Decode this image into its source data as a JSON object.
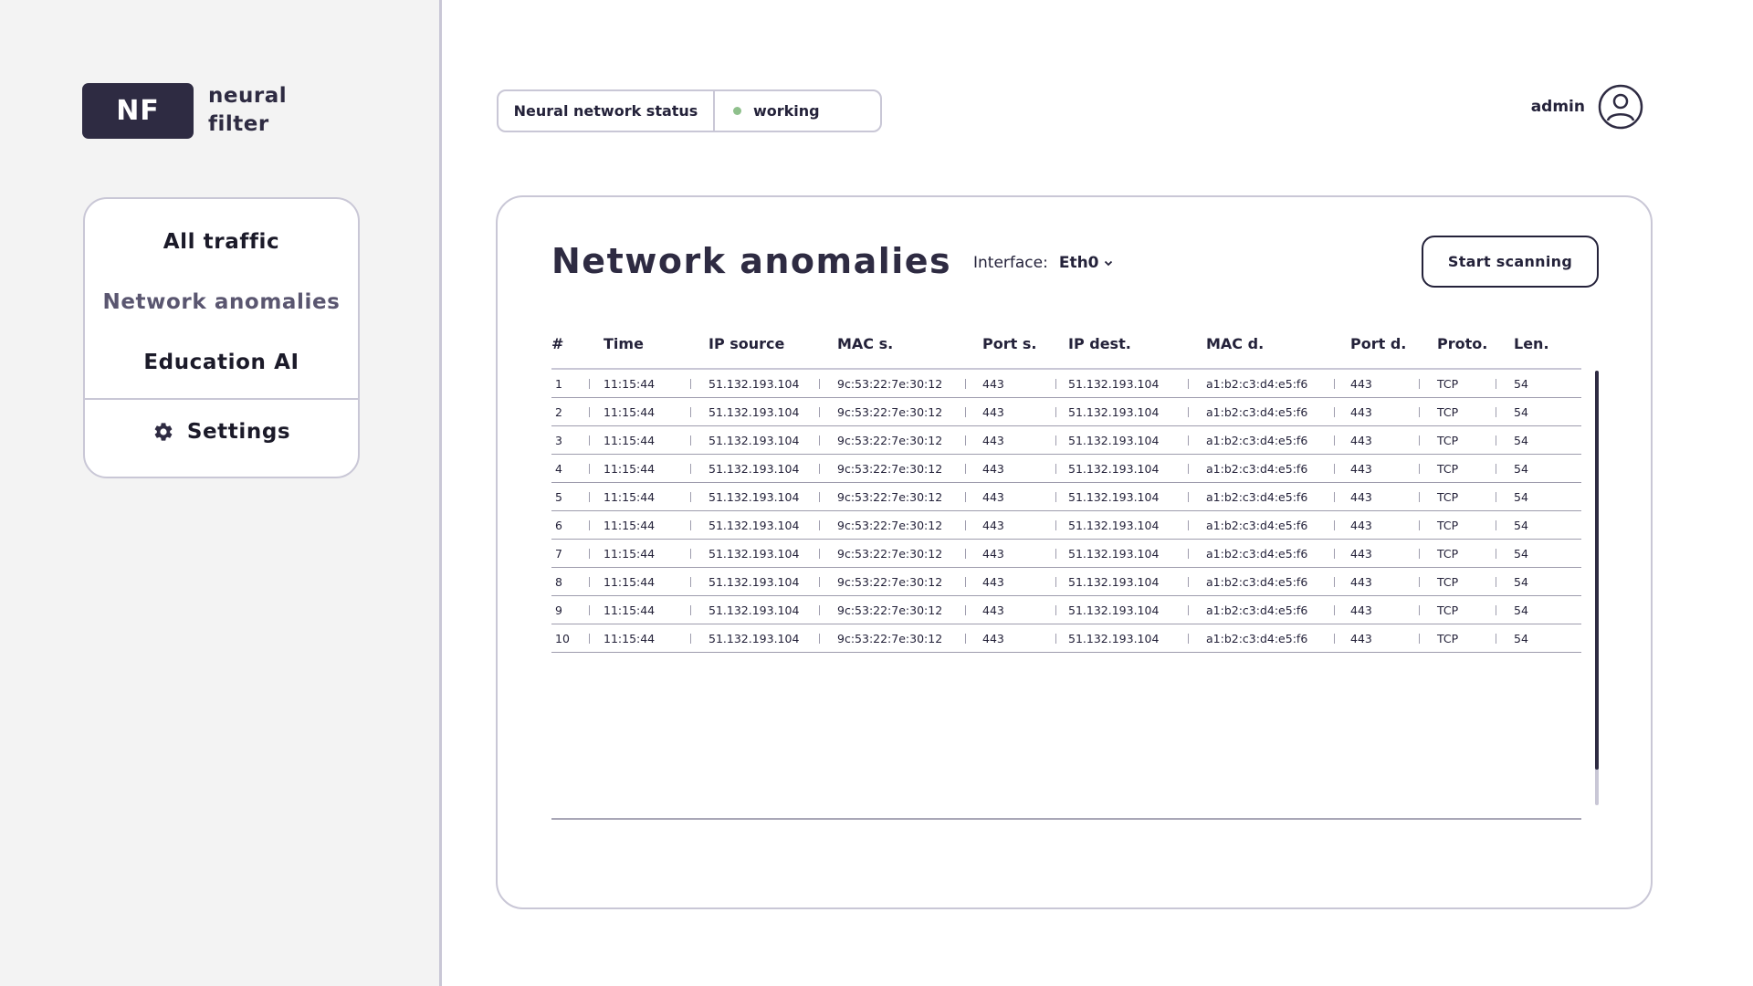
{
  "logo": {
    "badge": "NF",
    "line1": "neural",
    "line2": "filter"
  },
  "nav": {
    "items": [
      {
        "label": "All traffic"
      },
      {
        "label": "Network anomalies"
      },
      {
        "label": "Education AI"
      }
    ],
    "settings_label": "Settings",
    "settings_icon": "gear-icon"
  },
  "status": {
    "label": "Neural network status",
    "value": "working",
    "dot_color": "#8fc08c"
  },
  "user": {
    "name": "admin",
    "icon": "user-circle-icon"
  },
  "main": {
    "title": "Network anomalies",
    "interface_label": "Interface:",
    "interface_value": "Eth0",
    "scan_button": "Start scanning"
  },
  "table": {
    "columns": [
      "#",
      "Time",
      "IP source",
      "MAC s.",
      "Port s.",
      "IP dest.",
      "MAC d.",
      "Port d.",
      "Proto.",
      "Len."
    ],
    "rows": [
      [
        "1",
        "11:15:44",
        "51.132.193.104",
        "9c:53:22:7e:30:12",
        "443",
        "51.132.193.104",
        "a1:b2:c3:d4:e5:f6",
        "443",
        "TCP",
        "54"
      ],
      [
        "2",
        "11:15:44",
        "51.132.193.104",
        "9c:53:22:7e:30:12",
        "443",
        "51.132.193.104",
        "a1:b2:c3:d4:e5:f6",
        "443",
        "TCP",
        "54"
      ],
      [
        "3",
        "11:15:44",
        "51.132.193.104",
        "9c:53:22:7e:30:12",
        "443",
        "51.132.193.104",
        "a1:b2:c3:d4:e5:f6",
        "443",
        "TCP",
        "54"
      ],
      [
        "4",
        "11:15:44",
        "51.132.193.104",
        "9c:53:22:7e:30:12",
        "443",
        "51.132.193.104",
        "a1:b2:c3:d4:e5:f6",
        "443",
        "TCP",
        "54"
      ],
      [
        "5",
        "11:15:44",
        "51.132.193.104",
        "9c:53:22:7e:30:12",
        "443",
        "51.132.193.104",
        "a1:b2:c3:d4:e5:f6",
        "443",
        "TCP",
        "54"
      ],
      [
        "6",
        "11:15:44",
        "51.132.193.104",
        "9c:53:22:7e:30:12",
        "443",
        "51.132.193.104",
        "a1:b2:c3:d4:e5:f6",
        "443",
        "TCP",
        "54"
      ],
      [
        "7",
        "11:15:44",
        "51.132.193.104",
        "9c:53:22:7e:30:12",
        "443",
        "51.132.193.104",
        "a1:b2:c3:d4:e5:f6",
        "443",
        "TCP",
        "54"
      ],
      [
        "8",
        "11:15:44",
        "51.132.193.104",
        "9c:53:22:7e:30:12",
        "443",
        "51.132.193.104",
        "a1:b2:c3:d4:e5:f6",
        "443",
        "TCP",
        "54"
      ],
      [
        "9",
        "11:15:44",
        "51.132.193.104",
        "9c:53:22:7e:30:12",
        "443",
        "51.132.193.104",
        "a1:b2:c3:d4:e5:f6",
        "443",
        "TCP",
        "54"
      ],
      [
        "10",
        "11:15:44",
        "51.132.193.104",
        "9c:53:22:7e:30:12",
        "443",
        "51.132.193.104",
        "a1:b2:c3:d4:e5:f6",
        "443",
        "TCP",
        "54"
      ]
    ]
  },
  "colors": {
    "accent": "#2e2b42",
    "border": "#c9c7d6",
    "status_ok": "#8fc08c",
    "sidebar_bg": "#f3f3f3"
  }
}
